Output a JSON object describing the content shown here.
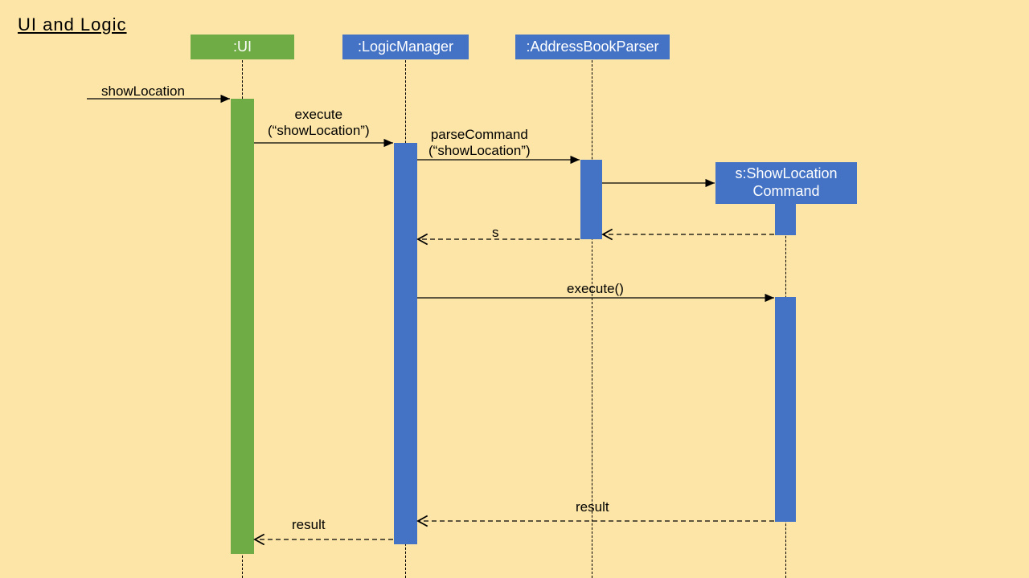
{
  "title": "UI and Logic",
  "lifelines": {
    "ui": ":UI",
    "logicManager": ":LogicManager",
    "addressBookParser": ":AddressBookParser",
    "showLocationCommand": "s:ShowLocation\nCommand"
  },
  "messages": {
    "showLocation": "showLocation",
    "execute": "execute\n(“showLocation”)",
    "parseCommand": "parseCommand\n(“showLocation”)",
    "returnS": "s",
    "executeCall": "execute()",
    "resultToLogic": "result",
    "resultToUI": "result"
  },
  "colors": {
    "green": "#6fac46",
    "blue": "#4472c4",
    "bg": "#fde5a7"
  }
}
